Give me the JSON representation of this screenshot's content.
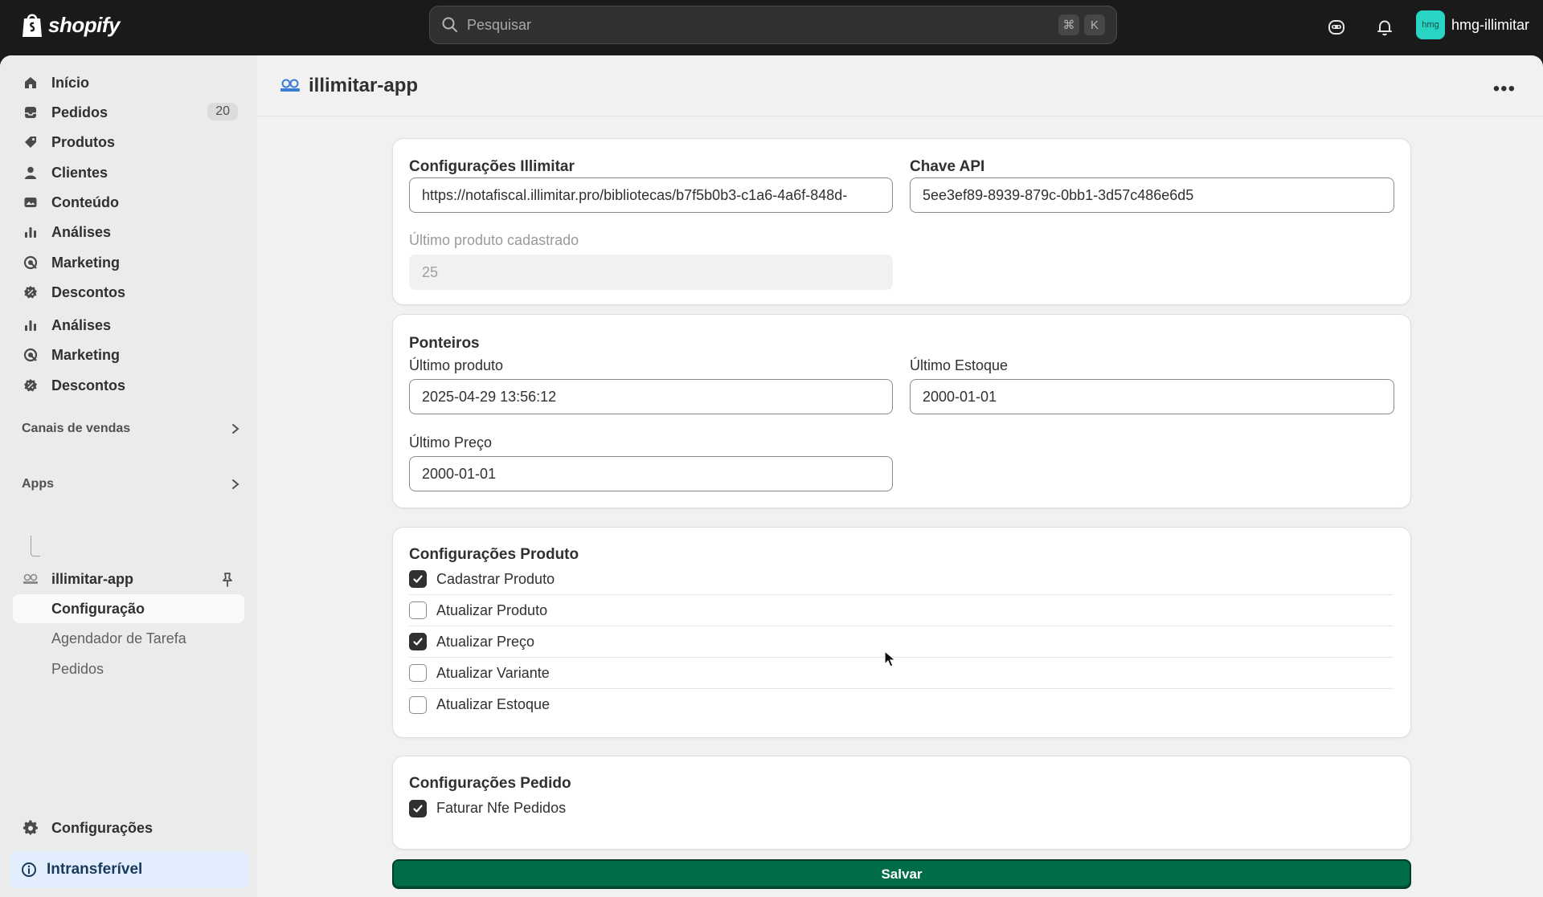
{
  "topbar": {
    "brand": "shopify",
    "search_placeholder": "Pesquisar",
    "shortcut_cmd": "⌘",
    "shortcut_key": "K",
    "avatar_initials": "hmg",
    "account_name": "hmg-illimitar"
  },
  "sidebar": {
    "items": [
      {
        "label": "Início",
        "icon": "home-icon"
      },
      {
        "label": "Pedidos",
        "icon": "inbox-icon",
        "badge": "20"
      },
      {
        "label": "Produtos",
        "icon": "tag-icon"
      },
      {
        "label": "Clientes",
        "icon": "person-icon"
      },
      {
        "label": "Conteúdo",
        "icon": "content-icon"
      },
      {
        "label": "Análises",
        "icon": "bar-chart-icon"
      },
      {
        "label": "Marketing",
        "icon": "target-icon"
      },
      {
        "label": "Descontos",
        "icon": "discount-icon"
      },
      {
        "label": "Análises",
        "icon": "bar-chart-icon"
      },
      {
        "label": "Marketing",
        "icon": "target-icon"
      },
      {
        "label": "Descontos",
        "icon": "discount-icon"
      }
    ],
    "sales_channels": "Canais de vendas",
    "apps": "Apps",
    "app_name": "illimitar-app",
    "sub_items": [
      "Configuração",
      "Agendador de Tarefa",
      "Pedidos"
    ],
    "settings": "Configurações",
    "alert": "Intransferível"
  },
  "page": {
    "title": "illimitar-app",
    "more": "•••"
  },
  "illimitar": {
    "title": "Configurações Illimitar",
    "url_value": "https://notafiscal.illimitar.pro/bibliotecas/b7f5b0b3-c1a6-4a6f-848d-",
    "api_label": "Chave API",
    "api_value": "5ee3ef89-8939-879c-0bb1-3d57c486e6d5",
    "last_product_label": "Último produto cadastrado",
    "last_product_value": "25"
  },
  "ponteiros": {
    "title": "Ponteiros",
    "ultimo_produto_label": "Último produto",
    "ultimo_produto_value": "2025-04-29 13:56:12",
    "ultimo_estoque_label": "Último Estoque",
    "ultimo_estoque_value": "2000-01-01",
    "ultimo_preco_label": "Último Preço",
    "ultimo_preco_value": "2000-01-01"
  },
  "produto": {
    "title": "Configurações Produto",
    "options": [
      {
        "label": "Cadastrar Produto",
        "checked": true
      },
      {
        "label": "Atualizar Produto",
        "checked": false
      },
      {
        "label": "Atualizar Preço",
        "checked": true
      },
      {
        "label": "Atualizar Variante",
        "checked": false
      },
      {
        "label": "Atualizar Estoque",
        "checked": false
      }
    ]
  },
  "pedido": {
    "title": "Configurações Pedido",
    "options": [
      {
        "label": "Faturar Nfe Pedidos",
        "checked": true
      }
    ]
  },
  "save_label": "Salvar"
}
